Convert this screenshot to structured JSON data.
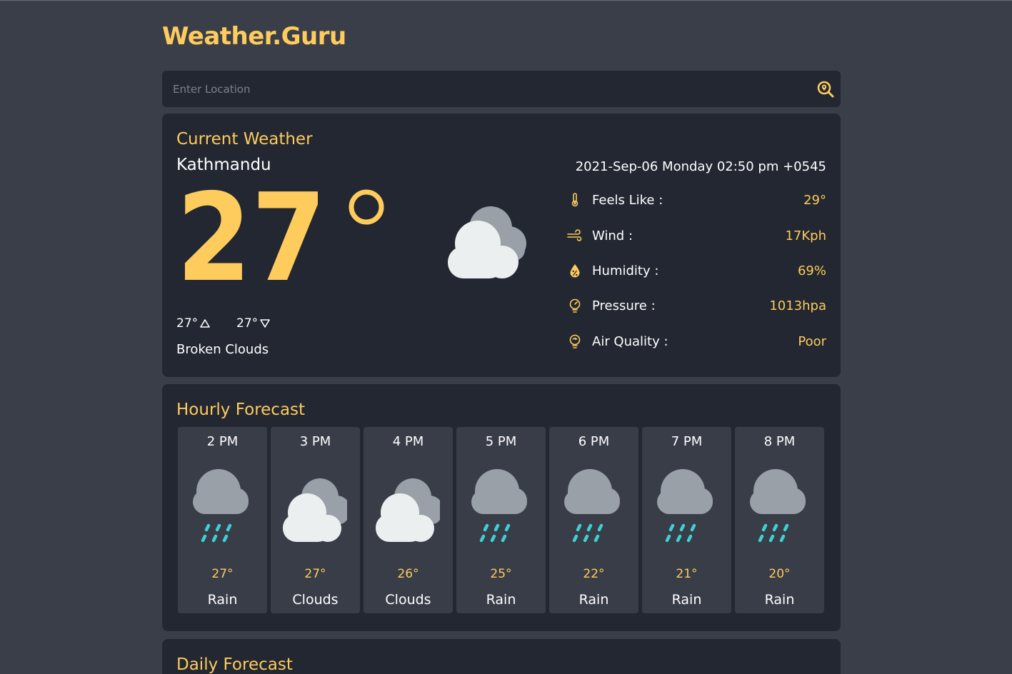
{
  "app": {
    "brand": "Weather.Guru",
    "accent": "#fecb5d"
  },
  "search": {
    "placeholder": "Enter Location",
    "icon": "search-location-icon"
  },
  "current": {
    "title": "Current Weather",
    "location": "Kathmandu",
    "datetime": "2021-Sep-06 Monday 02:50 pm +0545",
    "temp": "27°",
    "high": "27°",
    "low": "27°",
    "description": "Broken Clouds",
    "icon": "broken-clouds-icon",
    "stats": [
      {
        "label": "Feels Like :",
        "value": "29°",
        "icon": "thermometer-icon"
      },
      {
        "label": "Wind :",
        "value": "17Kph",
        "icon": "wind-icon"
      },
      {
        "label": "Humidity :",
        "value": "69%",
        "icon": "humidity-drop-icon"
      },
      {
        "label": "Pressure :",
        "value": "1013hpa",
        "icon": "pressure-gauge-icon"
      },
      {
        "label": "Air Quality :",
        "value": "Poor",
        "icon": "air-quality-icon"
      }
    ]
  },
  "hourly": {
    "title": "Hourly Forecast",
    "items": [
      {
        "time": "2 PM",
        "temp": "27°",
        "desc": "Rain",
        "icon": "rain-icon"
      },
      {
        "time": "3 PM",
        "temp": "27°",
        "desc": "Clouds",
        "icon": "clouds-icon"
      },
      {
        "time": "4 PM",
        "temp": "26°",
        "desc": "Clouds",
        "icon": "clouds-icon"
      },
      {
        "time": "5 PM",
        "temp": "25°",
        "desc": "Rain",
        "icon": "rain-icon"
      },
      {
        "time": "6 PM",
        "temp": "22°",
        "desc": "Rain",
        "icon": "rain-icon"
      },
      {
        "time": "7 PM",
        "temp": "21°",
        "desc": "Rain",
        "icon": "rain-icon"
      },
      {
        "time": "8 PM",
        "temp": "20°",
        "desc": "Rain",
        "icon": "rain-icon"
      }
    ]
  },
  "daily": {
    "title": "Daily Forecast"
  }
}
